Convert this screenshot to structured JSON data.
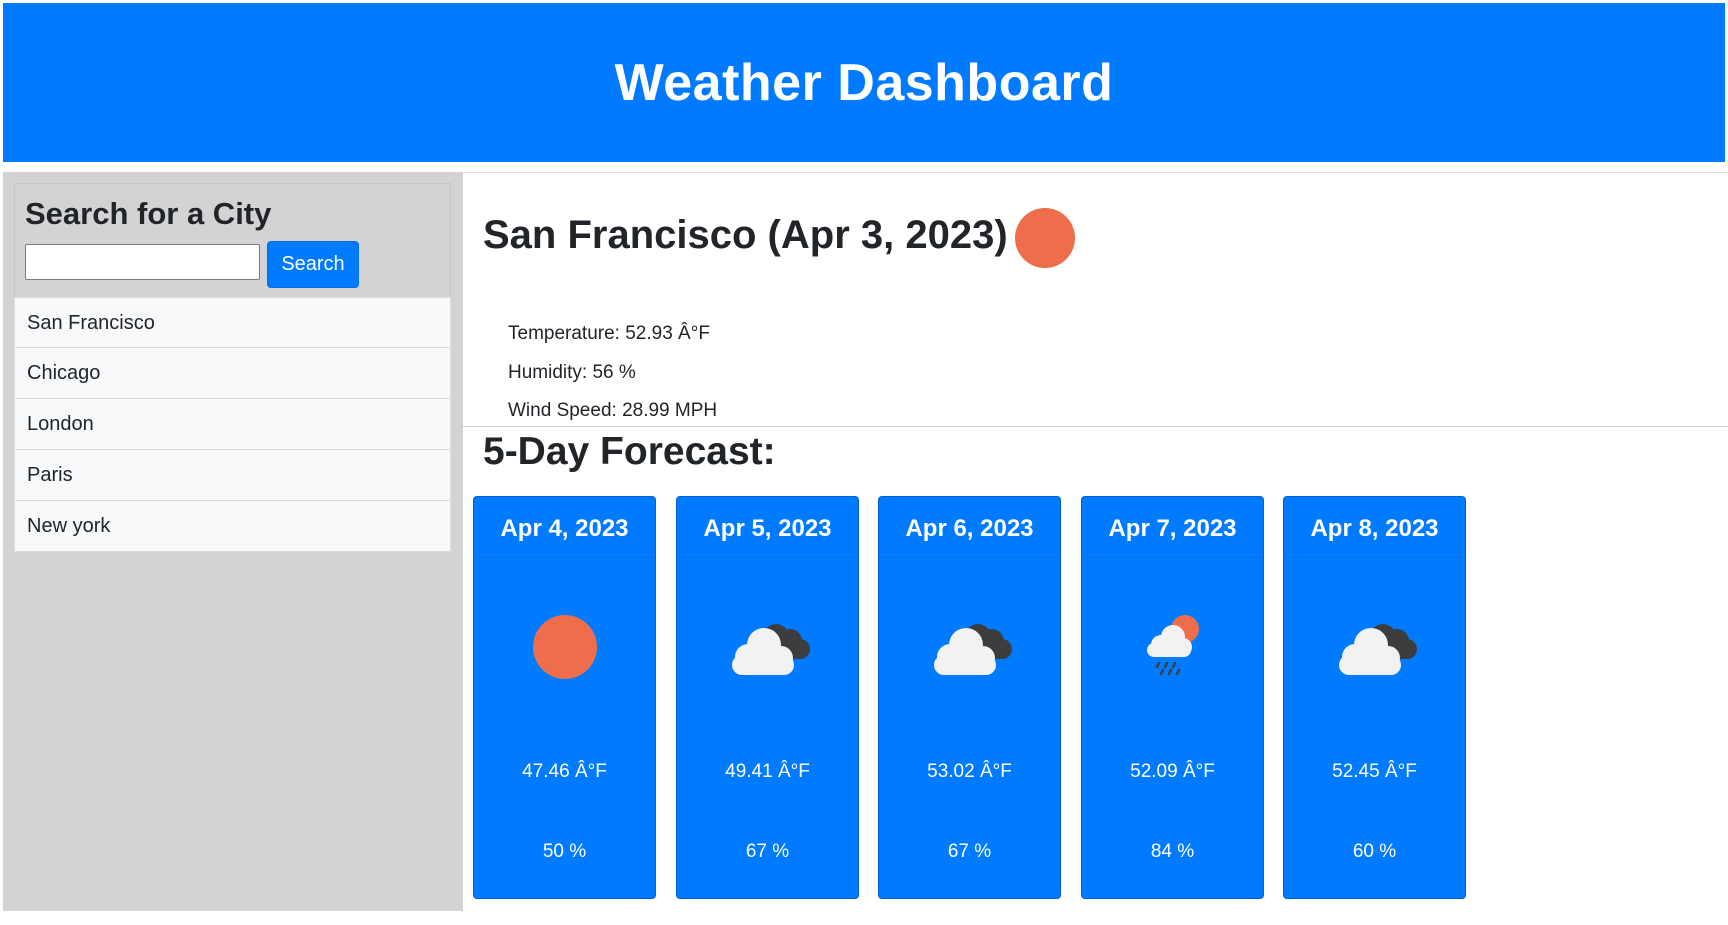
{
  "header": {
    "title": "Weather Dashboard"
  },
  "sidebar": {
    "search_title": "Search for a City",
    "search_value": "",
    "search_placeholder": "",
    "search_button_label": "Search",
    "history": [
      "San Francisco",
      "Chicago",
      "London",
      "Paris",
      "New york"
    ]
  },
  "current": {
    "title": "San Francisco (Apr 3, 2023)",
    "icon": "sun-icon",
    "temperature": "Temperature: 52.93 Â°F",
    "humidity": "Humidity: 56 %",
    "wind": "Wind Speed: 28.99 MPH"
  },
  "forecast": {
    "title": "5-Day Forecast:",
    "days": [
      {
        "date": "Apr 4, 2023",
        "icon": "sun-icon",
        "temp": "47.46 Â°F",
        "humidity": "50 %"
      },
      {
        "date": "Apr 5, 2023",
        "icon": "broken-clouds-icon",
        "temp": "49.41 Â°F",
        "humidity": "67 %"
      },
      {
        "date": "Apr 6, 2023",
        "icon": "broken-clouds-icon",
        "temp": "53.02 Â°F",
        "humidity": "67 %"
      },
      {
        "date": "Apr 7, 2023",
        "icon": "rain-sun-icon",
        "temp": "52.09 Â°F",
        "humidity": "84 %"
      },
      {
        "date": "Apr 8, 2023",
        "icon": "broken-clouds-icon",
        "temp": "52.45 Â°F",
        "humidity": "60 %"
      }
    ]
  },
  "colors": {
    "primary": "#007bff",
    "sidebar_bg": "#d3d3d3",
    "sun": "#ee6e4c",
    "cloud_light": "#f2f2f2",
    "cloud_dark": "#3d3d3f"
  }
}
